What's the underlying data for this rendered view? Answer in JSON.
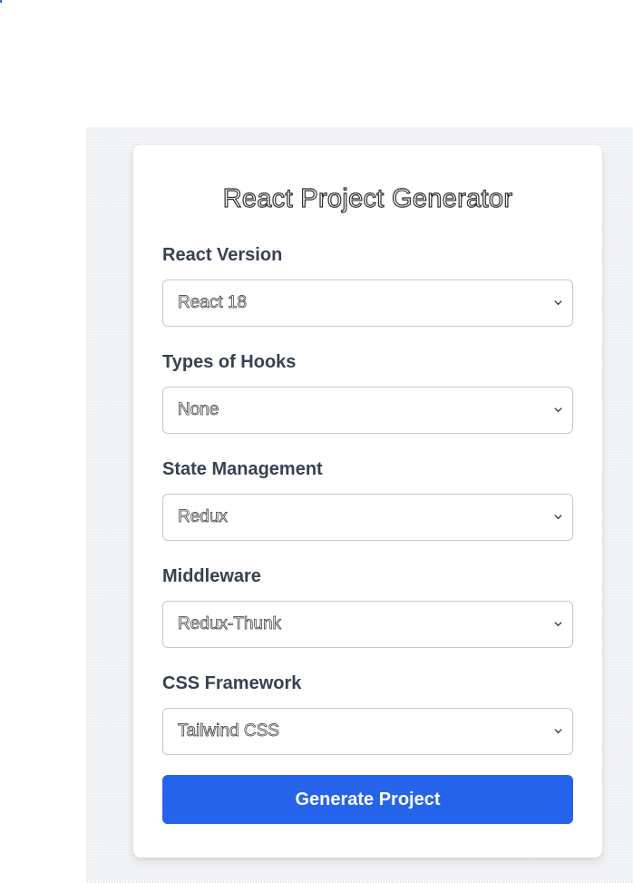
{
  "title": "React Project Generator",
  "fields": [
    {
      "label": "React Version",
      "value": "React 18"
    },
    {
      "label": "Types of Hooks",
      "value": "None"
    },
    {
      "label": "State Management",
      "value": "Redux"
    },
    {
      "label": "Middleware",
      "value": "Redux-Thunk"
    },
    {
      "label": "CSS Framework",
      "value": "Tailwind CSS"
    }
  ],
  "button": {
    "label": "Generate Project"
  },
  "colors": {
    "accent": "#2563eb",
    "label_text": "#374151",
    "page_background": "#f3f4f6"
  },
  "icons": {
    "select_arrow": "chevron-down-icon"
  }
}
